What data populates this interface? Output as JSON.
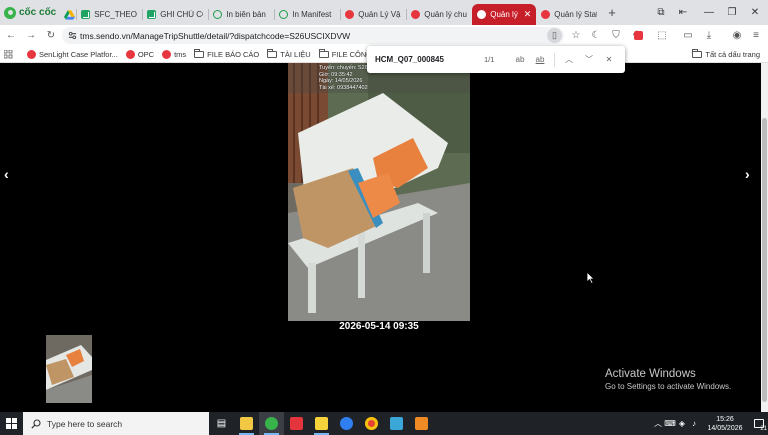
{
  "browser": {
    "brand": "cốc cốc",
    "tabs": [
      {
        "label": "",
        "icon": "google-drive-icon"
      },
      {
        "label": "SFC_THEO D",
        "icon": "google-sheets-icon"
      },
      {
        "label": "GHI CHÚ CÔ",
        "icon": "google-sheets-icon"
      },
      {
        "label": "In biên bản",
        "icon": "globe-icon"
      },
      {
        "label": "In Manifest",
        "icon": "globe-icon"
      },
      {
        "label": "Quản Lý Vận",
        "icon": "sendo-icon"
      },
      {
        "label": "Quản lý chuy",
        "icon": "sendo-icon"
      },
      {
        "label": "Quản lý",
        "icon": "sendo-icon",
        "active": true
      },
      {
        "label": "Quản lý Stat",
        "icon": "sendo-icon"
      }
    ],
    "url": "tms.sendo.vn/ManageTripShuttle/detail/?dispatchcode=S26USCIXDVW",
    "bookmarks": [
      {
        "label": "SenLight Case Platfor...",
        "icon": "sendo-icon"
      },
      {
        "label": "OPC",
        "icon": "sendo-icon"
      },
      {
        "label": "tms",
        "icon": "sendo-icon"
      },
      {
        "label": "FILE BÁO CÁO",
        "icon": "folder-icon"
      },
      {
        "label": "TÀI LIỆU",
        "icon": "folder-icon"
      },
      {
        "label": "FILE CÔNG VIỆC",
        "icon": "folder-icon"
      }
    ],
    "bookmarks_all": "Tất cả dấu trang"
  },
  "find": {
    "query": "HCM_Q07_000845",
    "count": "1/1"
  },
  "viewer": {
    "stamp": "Tuyến: chuyến: S26...\nGiờ: 09:35:42\nNgày: 14/05/2026\nTài xế: 0938447402",
    "caption": "2026-05-14 09:35"
  },
  "watermark": {
    "title": "Activate Windows",
    "subtitle": "Go to Settings to activate Windows."
  },
  "taskbar": {
    "search_placeholder": "Type here to search",
    "time": "15:26",
    "date": "14/05/2026",
    "notifications": "21"
  }
}
